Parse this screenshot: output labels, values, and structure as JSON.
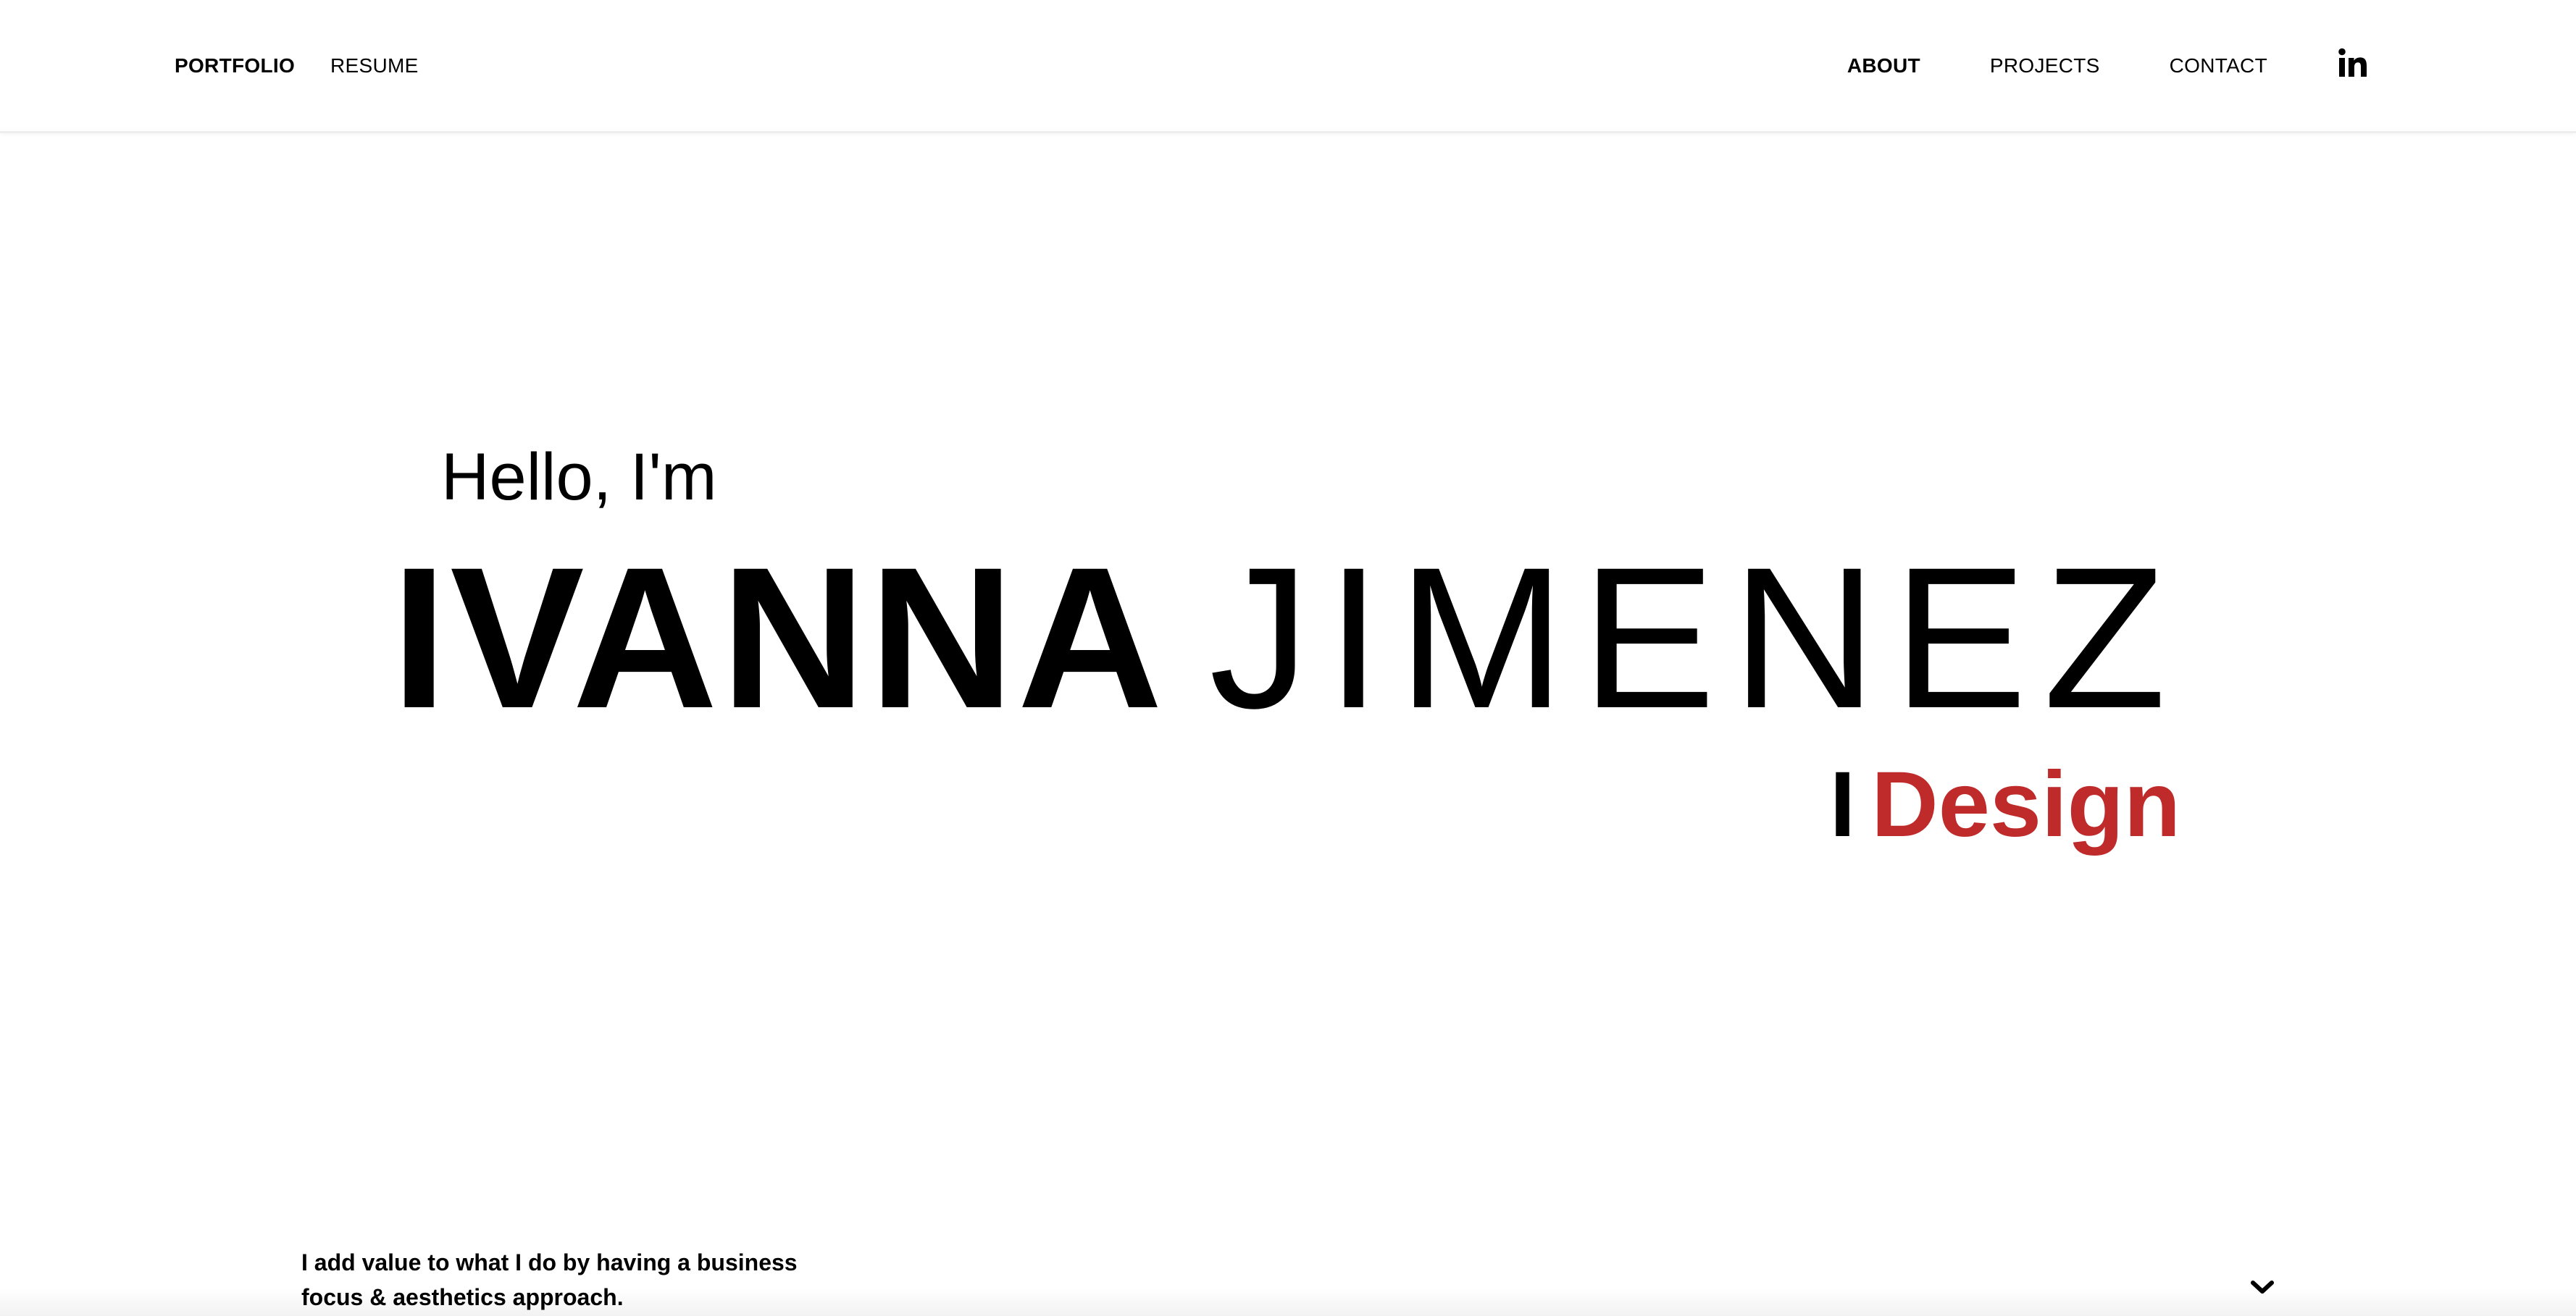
{
  "nav": {
    "left": [
      {
        "label": "PORTFOLIO",
        "bold": true
      },
      {
        "label": "RESUME",
        "bold": false
      }
    ],
    "right": [
      {
        "label": "ABOUT",
        "bold": true
      },
      {
        "label": "PROJECTS",
        "bold": false
      },
      {
        "label": "CONTACT",
        "bold": false
      }
    ],
    "social_icon": "linkedin-icon"
  },
  "hero": {
    "greeting": "Hello, I'm",
    "first_name": "IVANNA",
    "last_name": "JIMENEZ",
    "tagline_prefix": "I",
    "tagline_word": "Design"
  },
  "intro": {
    "line1": "I add value to what I do by having a business",
    "line2": "focus & aesthetics approach."
  },
  "colors": {
    "accent": "#bf2b2b",
    "text": "#000000",
    "background": "#ffffff"
  },
  "icons": {
    "scroll": "chevron-down-icon"
  }
}
